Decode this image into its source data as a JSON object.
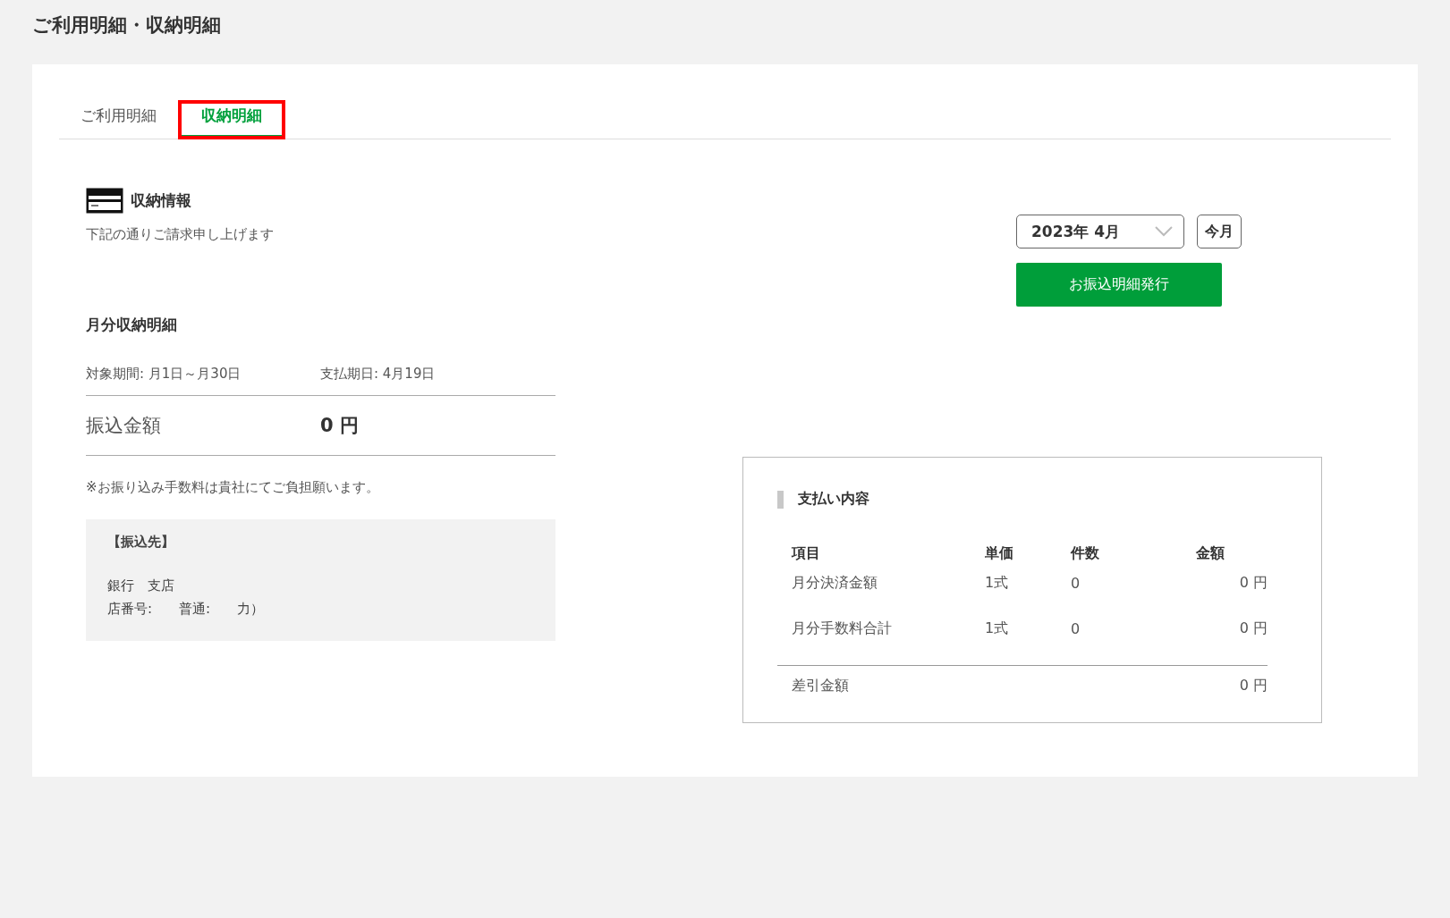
{
  "page_title": "ご利用明細・収納明細",
  "tabs": [
    {
      "label": "ご利用明細",
      "selected": false,
      "highlighted": false
    },
    {
      "label": "収納明細",
      "selected": true,
      "highlighted": true
    }
  ],
  "section": {
    "title": "収納情報",
    "subtitle": "下記の通りご請求申し上げます"
  },
  "month_picker": {
    "value": "2023年 4月",
    "this_month_button": "今月"
  },
  "issue_button": "お振込明細発行",
  "monthly": {
    "title": "月分収納明細",
    "period": "対象期間: 月1日～月30日",
    "due_date": "支払期日: 4月19日",
    "amount_label": "振込金額",
    "amount": "0 円",
    "note": "※お振り込み手数料は貴社にてご負担願います。"
  },
  "transfer_to": {
    "title": "【振込先】",
    "lines": [
      "銀行　支店",
      "店番号:　　普通:　　力）"
    ]
  },
  "payment": {
    "title": "支払い内容",
    "columns": [
      "項目",
      "単価",
      "件数",
      "金額"
    ],
    "rows": [
      {
        "item": "月分決済金額",
        "unit_price": "1式",
        "count": "0",
        "amount": "0 円"
      },
      {
        "item": "月分手数料合計",
        "unit_price": "1式",
        "count": "0",
        "amount": "0 円"
      }
    ],
    "total": {
      "label": "差引金額",
      "amount": "0 円"
    }
  }
}
